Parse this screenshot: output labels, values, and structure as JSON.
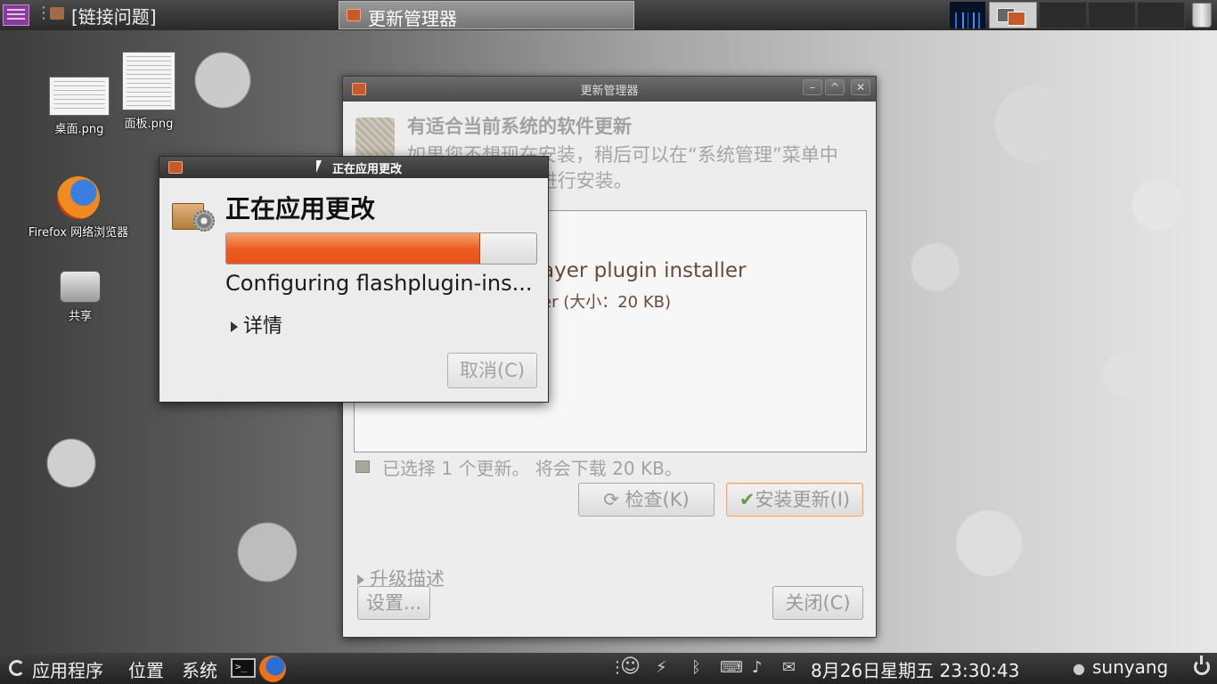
{
  "top_panel": {
    "window_label": "[链接问题]",
    "task_label": "更新管理器"
  },
  "desktop_icons": [
    {
      "label": "桌面.png"
    },
    {
      "label": "面板.png"
    },
    {
      "label": "Firefox 网络浏览器"
    },
    {
      "label": "共享"
    }
  ],
  "update_manager": {
    "title": "更新管理器",
    "header_title": "有适合当前系统的软件更新",
    "header_desc": "如果您不想现在安装，稍后可以在“系统管理”菜单中的“更新管理器”进行安装。",
    "package_name": "ayer plugin installer",
    "package_size": "er (大小：20 KB)",
    "selection_text": "已选择 1 个更新。 将会下载 20 KB。",
    "check_button": "检查(K)",
    "install_button": "安装更新(I)",
    "upgrade_desc": "升级描述",
    "settings_button": "设置...",
    "close_button": "关闭(C)"
  },
  "progress_dialog": {
    "title": "正在应用更改",
    "heading": "正在应用更改",
    "progress_fraction": 0.82,
    "status": "Configuring flashplugin-ins...",
    "details": "详情",
    "cancel_button": "取消(C)"
  },
  "bottom_panel": {
    "menu_apps": "应用程序",
    "menu_places": "位置",
    "menu_system": "系统",
    "clock": "8月26日星期五 23:30:43",
    "user": "sunyang"
  },
  "colors": {
    "progress_accent": "#ec5a1e",
    "panel_bg": "#2f2f2f"
  }
}
